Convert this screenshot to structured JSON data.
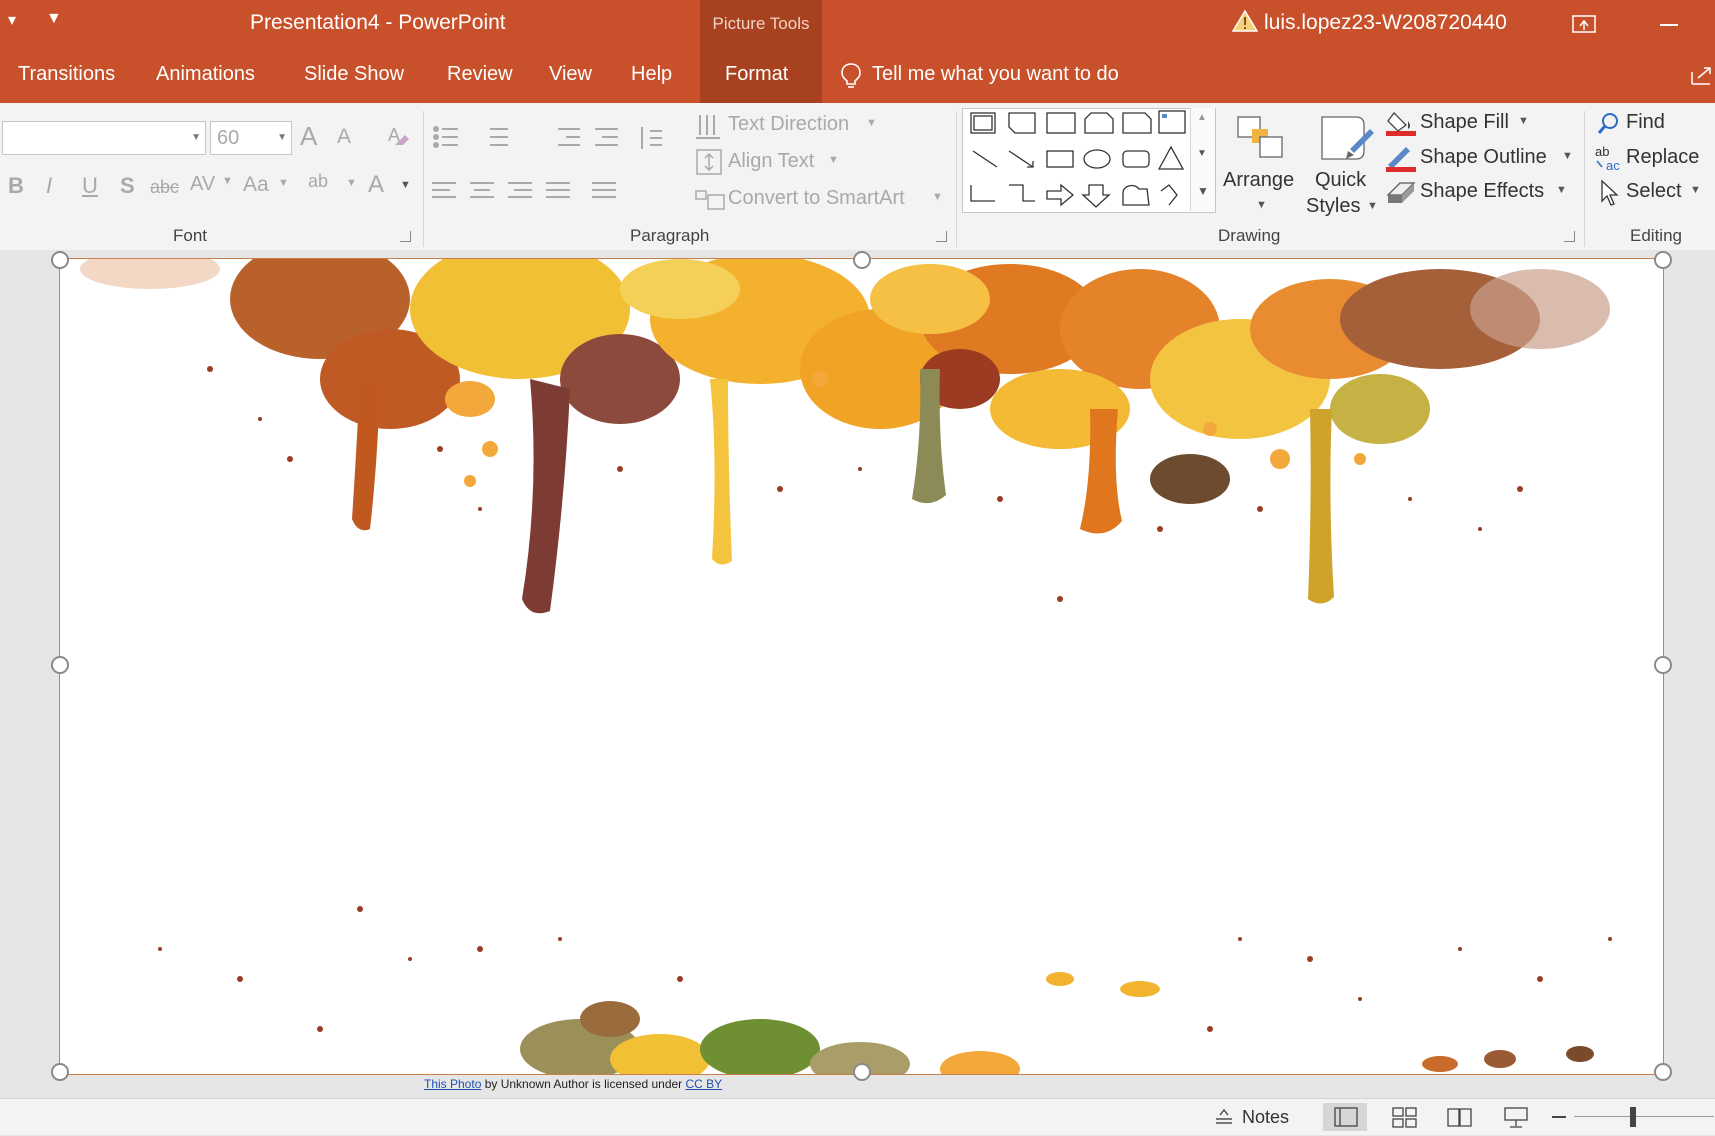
{
  "titlebar": {
    "doc_name": "Presentation4  -  PowerPoint",
    "contextual_group": "Picture Tools",
    "user": "luis.lopez23-W208720440"
  },
  "tabs": [
    "Transitions",
    "Animations",
    "Slide Show",
    "Review",
    "View",
    "Help",
    "Format"
  ],
  "tell_me": "Tell me what you want to do",
  "font_group": {
    "label": "Font",
    "font_name": "",
    "font_size": "60",
    "btn_bold": "B",
    "btn_italic": "I",
    "btn_underline": "U",
    "btn_shadow": "S",
    "btn_strike": "abc",
    "btn_spacing": "AV",
    "btn_case": "Aa",
    "btn_grow": "A",
    "btn_shrink": "A",
    "btn_color": "A",
    "btn_highlight": "ab"
  },
  "paragraph_group": {
    "label": "Paragraph",
    "text_direction": "Text Direction",
    "align_text": "Align Text",
    "smartart": "Convert to SmartArt"
  },
  "drawing_group": {
    "label": "Drawing",
    "arrange": "Arrange",
    "quick_styles_1": "Quick",
    "quick_styles_2": "Styles",
    "shape_fill": "Shape Fill",
    "shape_outline": "Shape Outline",
    "shape_effects": "Shape Effects"
  },
  "editing_group": {
    "label": "Editing",
    "find": "Find",
    "replace": "Replace",
    "select": "Select"
  },
  "attribution": {
    "photo_link": "This Photo",
    "middle": " by Unknown Author is licensed under ",
    "license_link": "CC BY"
  },
  "statusbar": {
    "notes": "Notes"
  },
  "colors": {
    "accent": "#c8502a",
    "contextual": "#a8411f"
  }
}
